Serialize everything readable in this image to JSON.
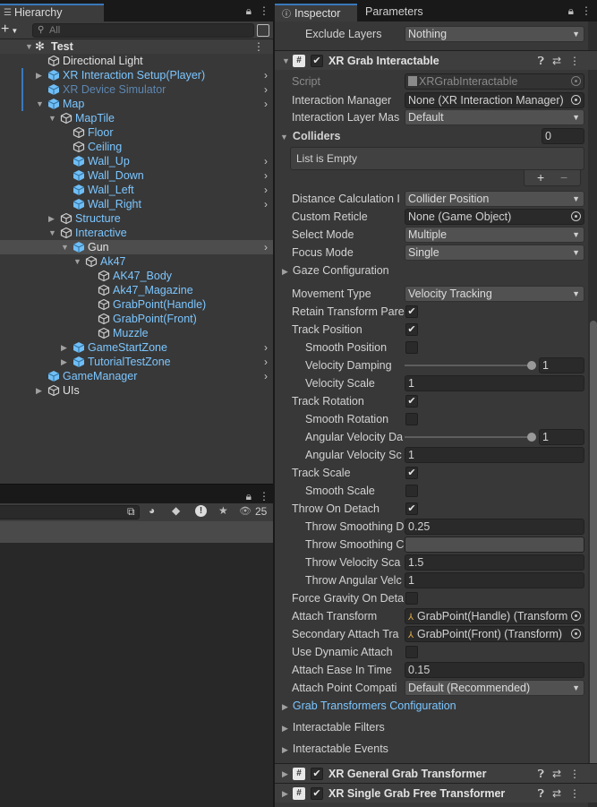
{
  "colors": {
    "accent": "#3a79bb",
    "prefab_blue": "#7cc6ff",
    "panel_bg": "#383838",
    "field_bg": "#2a2a2a"
  },
  "hierarchy": {
    "tab_label": "Hierarchy",
    "add_label": "+",
    "search_placeholder": "All",
    "scene": "Test",
    "items": [
      {
        "label": "Directional Light",
        "icon": "gameobject-icon"
      },
      {
        "label": "XR Interaction Setup(Player)",
        "icon": "prefab-icon"
      },
      {
        "label": "XR Device Simulator",
        "icon": "prefab-icon"
      },
      {
        "label": "Map",
        "icon": "prefab-icon"
      },
      {
        "label": "MapTile",
        "icon": "gameobject-icon"
      },
      {
        "label": "Floor",
        "icon": "gameobject-icon"
      },
      {
        "label": "Ceiling",
        "icon": "gameobject-icon"
      },
      {
        "label": "Wall_Up",
        "icon": "prefab-icon"
      },
      {
        "label": "Wall_Down",
        "icon": "prefab-icon"
      },
      {
        "label": "Wall_Left",
        "icon": "prefab-icon"
      },
      {
        "label": "Wall_Right",
        "icon": "prefab-icon"
      },
      {
        "label": "Structure",
        "icon": "gameobject-icon"
      },
      {
        "label": "Interactive",
        "icon": "gameobject-icon"
      },
      {
        "label": "Gun",
        "icon": "prefab-icon"
      },
      {
        "label": "Ak47",
        "icon": "gameobject-icon"
      },
      {
        "label": "AK47_Body",
        "icon": "gameobject-icon"
      },
      {
        "label": "Ak47_Magazine",
        "icon": "gameobject-icon"
      },
      {
        "label": "GrabPoint(Handle)",
        "icon": "gameobject-icon"
      },
      {
        "label": "GrabPoint(Front)",
        "icon": "gameobject-icon"
      },
      {
        "label": "Muzzle",
        "icon": "gameobject-icon"
      },
      {
        "label": "GameStartZone",
        "icon": "prefab-icon"
      },
      {
        "label": "TutorialTestZone",
        "icon": "prefab-icon"
      },
      {
        "label": "GameManager",
        "icon": "prefab-icon"
      },
      {
        "label": "UIs",
        "icon": "gameobject-icon"
      }
    ]
  },
  "bottom_panel": {
    "hidden_count": "25"
  },
  "inspector": {
    "tabs": [
      "Inspector",
      "Parameters"
    ],
    "exclude_layers": {
      "label": "Exclude Layers",
      "value": "Nothing"
    },
    "component": "XR Grab Interactable",
    "script": {
      "label": "Script",
      "value": "XRGrabInteractable"
    },
    "interaction_manager": {
      "label": "Interaction Manager",
      "value": "None (XR Interaction Manager)"
    },
    "interaction_layer_mask": {
      "label": "Interaction Layer Mas",
      "value": "Default"
    },
    "colliders": {
      "label": "Colliders",
      "count": "0",
      "empty": "List is Empty",
      "add": "+",
      "remove": "−"
    },
    "distance_calc": {
      "label": "Distance Calculation I",
      "value": "Collider Position"
    },
    "custom_reticle": {
      "label": "Custom Reticle",
      "value": "None (Game Object)"
    },
    "select_mode": {
      "label": "Select Mode",
      "value": "Multiple"
    },
    "focus_mode": {
      "label": "Focus Mode",
      "value": "Single"
    },
    "gaze_config": "Gaze Configuration",
    "movement_type": {
      "label": "Movement Type",
      "value": "Velocity Tracking"
    },
    "retain_transform": {
      "label": "Retain Transform Pare",
      "checked": true
    },
    "track_position": {
      "label": "Track Position",
      "checked": true
    },
    "smooth_position": {
      "label": "Smooth Position",
      "checked": false
    },
    "velocity_damping": {
      "label": "Velocity Damping",
      "value": "1",
      "fraction": 1.0
    },
    "velocity_scale": {
      "label": "Velocity Scale",
      "value": "1"
    },
    "track_rotation": {
      "label": "Track Rotation",
      "checked": true
    },
    "smooth_rotation": {
      "label": "Smooth Rotation",
      "checked": false
    },
    "angular_velocity_damping": {
      "label": "Angular Velocity Da",
      "value": "1",
      "fraction": 1.0
    },
    "angular_velocity_scale": {
      "label": "Angular Velocity Sc",
      "value": "1"
    },
    "track_scale": {
      "label": "Track Scale",
      "checked": true
    },
    "smooth_scale": {
      "label": "Smooth Scale",
      "checked": false
    },
    "throw_on_detach": {
      "label": "Throw On Detach",
      "checked": true
    },
    "throw_smoothing_duration": {
      "label": "Throw Smoothing D",
      "value": "0.25"
    },
    "throw_smoothing_curve": {
      "label": "Throw Smoothing C"
    },
    "throw_velocity_scale": {
      "label": "Throw Velocity Sca",
      "value": "1.5"
    },
    "throw_angular_velocity": {
      "label": "Throw Angular Velc",
      "value": "1"
    },
    "force_gravity": {
      "label": "Force Gravity On Deta",
      "checked": false
    },
    "attach_transform": {
      "label": "Attach Transform",
      "value": "GrabPoint(Handle) (Transform"
    },
    "secondary_attach": {
      "label": "Secondary Attach Tra",
      "value": "GrabPoint(Front) (Transform)"
    },
    "dynamic_attach": {
      "label": "Use Dynamic Attach",
      "checked": false
    },
    "attach_ease": {
      "label": "Attach Ease In Time",
      "value": "0.15"
    },
    "attach_point_compat": {
      "label": "Attach Point Compati",
      "value": "Default (Recommended)"
    },
    "grab_transformers_config": "Grab Transformers Configuration",
    "interactable_filters": "Interactable Filters",
    "interactable_events": "Interactable Events",
    "comp2": "XR General Grab Transformer",
    "comp3": "XR Single Grab Free Transformer"
  }
}
